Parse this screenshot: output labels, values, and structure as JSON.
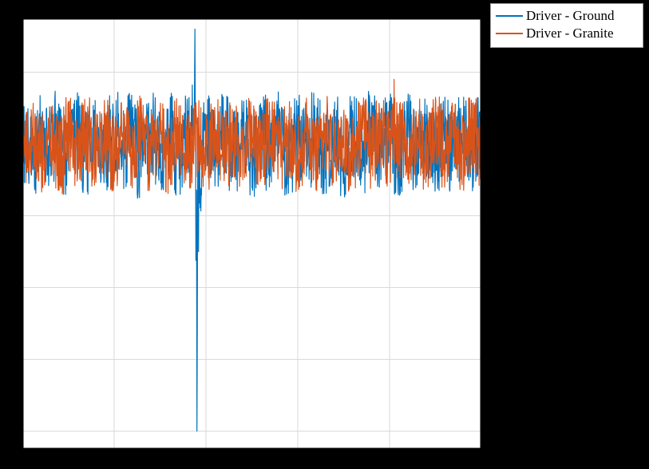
{
  "chart_data": {
    "type": "line",
    "title": "",
    "xlabel": "",
    "ylabel": "",
    "xlim": [
      0,
      5
    ],
    "ylim": [
      -0.85,
      0.35
    ],
    "x_ticks": [
      0,
      1,
      2,
      3,
      4,
      5
    ],
    "y_ticks": [
      -0.8,
      -0.6,
      -0.4,
      -0.2,
      0,
      0.2
    ],
    "legend_position": "outside-top-right",
    "grid": true,
    "series": [
      {
        "name": "Driver - Ground",
        "color": "#0072BD",
        "note": "Dense noisy signal centred near 0 with band roughly ±0.13; large transient spike near x≈1.9 reaching about +0.32 and −0.80.",
        "samples": [
          {
            "x": 0.0,
            "y": 0.02
          },
          {
            "x": 0.1,
            "y": -0.06
          },
          {
            "x": 0.2,
            "y": 0.09
          },
          {
            "x": 0.3,
            "y": -0.05
          },
          {
            "x": 0.4,
            "y": 0.11
          },
          {
            "x": 0.5,
            "y": -0.07
          },
          {
            "x": 0.6,
            "y": 0.08
          },
          {
            "x": 0.7,
            "y": -0.09
          },
          {
            "x": 0.8,
            "y": 0.05
          },
          {
            "x": 0.9,
            "y": -0.04
          },
          {
            "x": 1.0,
            "y": 0.1
          },
          {
            "x": 1.1,
            "y": -0.06
          },
          {
            "x": 1.2,
            "y": 0.07
          },
          {
            "x": 1.3,
            "y": -0.11
          },
          {
            "x": 1.4,
            "y": 0.09
          },
          {
            "x": 1.5,
            "y": -0.05
          },
          {
            "x": 1.6,
            "y": 0.12
          },
          {
            "x": 1.7,
            "y": -0.08
          },
          {
            "x": 1.8,
            "y": 0.06
          },
          {
            "x": 1.88,
            "y": 0.32
          },
          {
            "x": 1.9,
            "y": -0.8
          },
          {
            "x": 1.92,
            "y": -0.3
          },
          {
            "x": 2.0,
            "y": 0.05
          },
          {
            "x": 2.1,
            "y": -0.07
          },
          {
            "x": 2.2,
            "y": 0.1
          },
          {
            "x": 2.3,
            "y": -0.06
          },
          {
            "x": 2.4,
            "y": 0.08
          },
          {
            "x": 2.5,
            "y": -0.09
          },
          {
            "x": 2.6,
            "y": 0.07
          },
          {
            "x": 2.7,
            "y": -0.05
          },
          {
            "x": 2.8,
            "y": 0.11
          },
          {
            "x": 2.9,
            "y": -0.08
          },
          {
            "x": 3.0,
            "y": 0.06
          },
          {
            "x": 3.1,
            "y": -0.04
          },
          {
            "x": 3.2,
            "y": 0.09
          },
          {
            "x": 3.3,
            "y": -0.07
          },
          {
            "x": 3.4,
            "y": 0.05
          },
          {
            "x": 3.5,
            "y": -0.1
          },
          {
            "x": 3.6,
            "y": 0.08
          },
          {
            "x": 3.7,
            "y": -0.06
          },
          {
            "x": 3.8,
            "y": 0.12
          },
          {
            "x": 3.9,
            "y": -0.05
          },
          {
            "x": 4.0,
            "y": 0.07
          },
          {
            "x": 4.1,
            "y": -0.09
          },
          {
            "x": 4.2,
            "y": 0.1
          },
          {
            "x": 4.3,
            "y": -0.04
          },
          {
            "x": 4.4,
            "y": 0.06
          },
          {
            "x": 4.5,
            "y": -0.08
          },
          {
            "x": 4.6,
            "y": 0.09
          },
          {
            "x": 4.7,
            "y": -0.06
          },
          {
            "x": 4.8,
            "y": 0.05
          },
          {
            "x": 4.9,
            "y": -0.07
          },
          {
            "x": 5.0,
            "y": 0.08
          }
        ]
      },
      {
        "name": "Driver - Granite",
        "color": "#D95319",
        "note": "Dense noisy signal centred near 0 with band roughly ±0.12; no large transient.",
        "samples": [
          {
            "x": 0.0,
            "y": -0.03
          },
          {
            "x": 0.1,
            "y": 0.06
          },
          {
            "x": 0.2,
            "y": -0.08
          },
          {
            "x": 0.3,
            "y": 0.05
          },
          {
            "x": 0.4,
            "y": -0.1
          },
          {
            "x": 0.5,
            "y": 0.07
          },
          {
            "x": 0.6,
            "y": -0.06
          },
          {
            "x": 0.7,
            "y": 0.09
          },
          {
            "x": 0.8,
            "y": -0.04
          },
          {
            "x": 0.9,
            "y": 0.05
          },
          {
            "x": 1.0,
            "y": -0.09
          },
          {
            "x": 1.1,
            "y": 0.06
          },
          {
            "x": 1.2,
            "y": -0.05
          },
          {
            "x": 1.3,
            "y": 0.1
          },
          {
            "x": 1.4,
            "y": -0.07
          },
          {
            "x": 1.5,
            "y": 0.04
          },
          {
            "x": 1.6,
            "y": -0.11
          },
          {
            "x": 1.7,
            "y": 0.08
          },
          {
            "x": 1.8,
            "y": -0.05
          },
          {
            "x": 1.9,
            "y": 0.06
          },
          {
            "x": 2.0,
            "y": -0.07
          },
          {
            "x": 2.1,
            "y": 0.09
          },
          {
            "x": 2.2,
            "y": -0.04
          },
          {
            "x": 2.3,
            "y": 0.05
          },
          {
            "x": 2.4,
            "y": -0.08
          },
          {
            "x": 2.5,
            "y": 0.07
          },
          {
            "x": 2.6,
            "y": -0.06
          },
          {
            "x": 2.7,
            "y": 0.1
          },
          {
            "x": 2.8,
            "y": -0.05
          },
          {
            "x": 2.9,
            "y": 0.04
          },
          {
            "x": 3.0,
            "y": -0.09
          },
          {
            "x": 3.1,
            "y": 0.06
          },
          {
            "x": 3.2,
            "y": -0.07
          },
          {
            "x": 3.3,
            "y": 0.08
          },
          {
            "x": 3.4,
            "y": -0.04
          },
          {
            "x": 3.5,
            "y": 0.05
          },
          {
            "x": 3.6,
            "y": -0.1
          },
          {
            "x": 3.7,
            "y": 0.07
          },
          {
            "x": 3.8,
            "y": -0.06
          },
          {
            "x": 3.9,
            "y": 0.09
          },
          {
            "x": 4.0,
            "y": -0.05
          },
          {
            "x": 4.05,
            "y": 0.18
          },
          {
            "x": 4.1,
            "y": 0.04
          },
          {
            "x": 4.2,
            "y": -0.08
          },
          {
            "x": 4.3,
            "y": 0.06
          },
          {
            "x": 4.4,
            "y": -0.07
          },
          {
            "x": 4.5,
            "y": 0.1
          },
          {
            "x": 4.6,
            "y": -0.05
          },
          {
            "x": 4.7,
            "y": 0.04
          },
          {
            "x": 4.8,
            "y": -0.09
          },
          {
            "x": 4.9,
            "y": 0.07
          },
          {
            "x": 5.0,
            "y": -0.06
          }
        ]
      }
    ]
  },
  "legend": {
    "items": [
      {
        "label": "Driver - Ground",
        "color": "#0072BD"
      },
      {
        "label": "Driver - Granite",
        "color": "#D95319"
      }
    ]
  }
}
